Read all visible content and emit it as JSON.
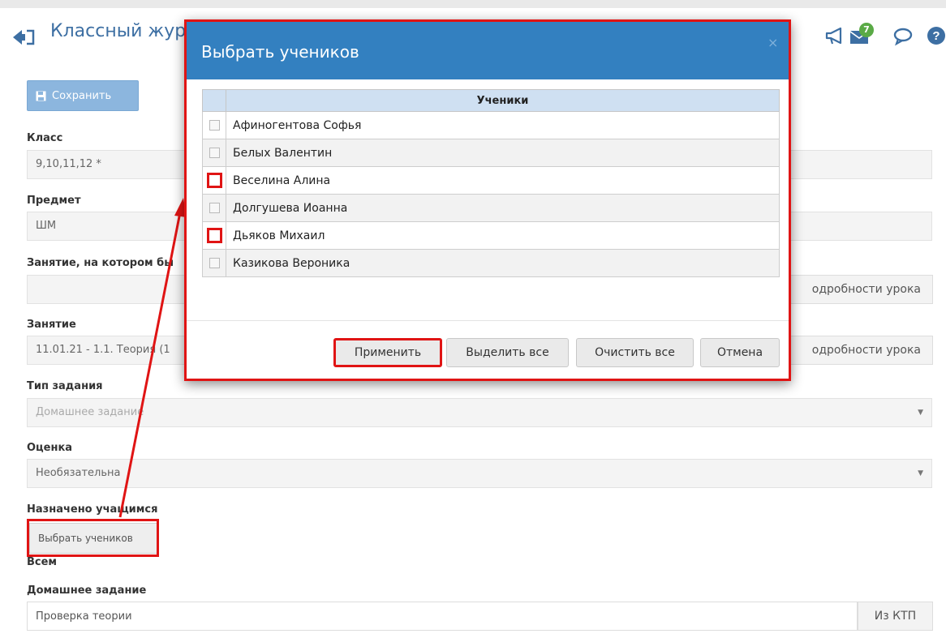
{
  "header": {
    "title": "Классный журнал",
    "notification_count": "7",
    "icons": [
      "back-icon",
      "megaphone-icon",
      "mail-icon",
      "chat-icon",
      "help-icon"
    ]
  },
  "form": {
    "save_label": "Сохранить",
    "class_label": "Класс",
    "class_value": "9,10,11,12 *",
    "subject_label": "Предмет",
    "subject_value": "ШМ",
    "lesson_given_label": "Занятие, на котором бы",
    "lesson_given_value": "",
    "lesson_details_label": "одробности урока",
    "lesson_label": "Занятие",
    "lesson_value": "11.01.21 - 1.1. Теория (1",
    "task_type_label": "Тип задания",
    "task_type_value": "Домашнее задание",
    "grade_label": "Оценка",
    "grade_value": "Необязательна",
    "assigned_label": "Назначено учащимся",
    "choose_students_label": "Выбрать учеников",
    "assigned_value": "Всем",
    "homework_label": "Домашнее задание",
    "homework_value": "Проверка теории",
    "from_ktp_label": "Из КТП"
  },
  "modal": {
    "title": "Выбрать учеников",
    "close": "×",
    "column_header": "Ученики",
    "students": [
      {
        "name": "Афиногентова Софья",
        "checked": false,
        "highlighted": false
      },
      {
        "name": "Белых Валентин",
        "checked": false,
        "highlighted": false
      },
      {
        "name": "Веселина Алина",
        "checked": false,
        "highlighted": true
      },
      {
        "name": "Долгушева Иоанна",
        "checked": false,
        "highlighted": false
      },
      {
        "name": "Дьяков Михаил",
        "checked": false,
        "highlighted": true
      },
      {
        "name": "Казикова Вероника",
        "checked": false,
        "highlighted": false
      }
    ],
    "buttons": {
      "apply": "Применить",
      "select_all": "Выделить все",
      "clear_all": "Очистить все",
      "cancel": "Отмена"
    }
  },
  "colors": {
    "accent": "#3380c0",
    "highlight": "#e01414",
    "badge": "#5aaa46"
  }
}
